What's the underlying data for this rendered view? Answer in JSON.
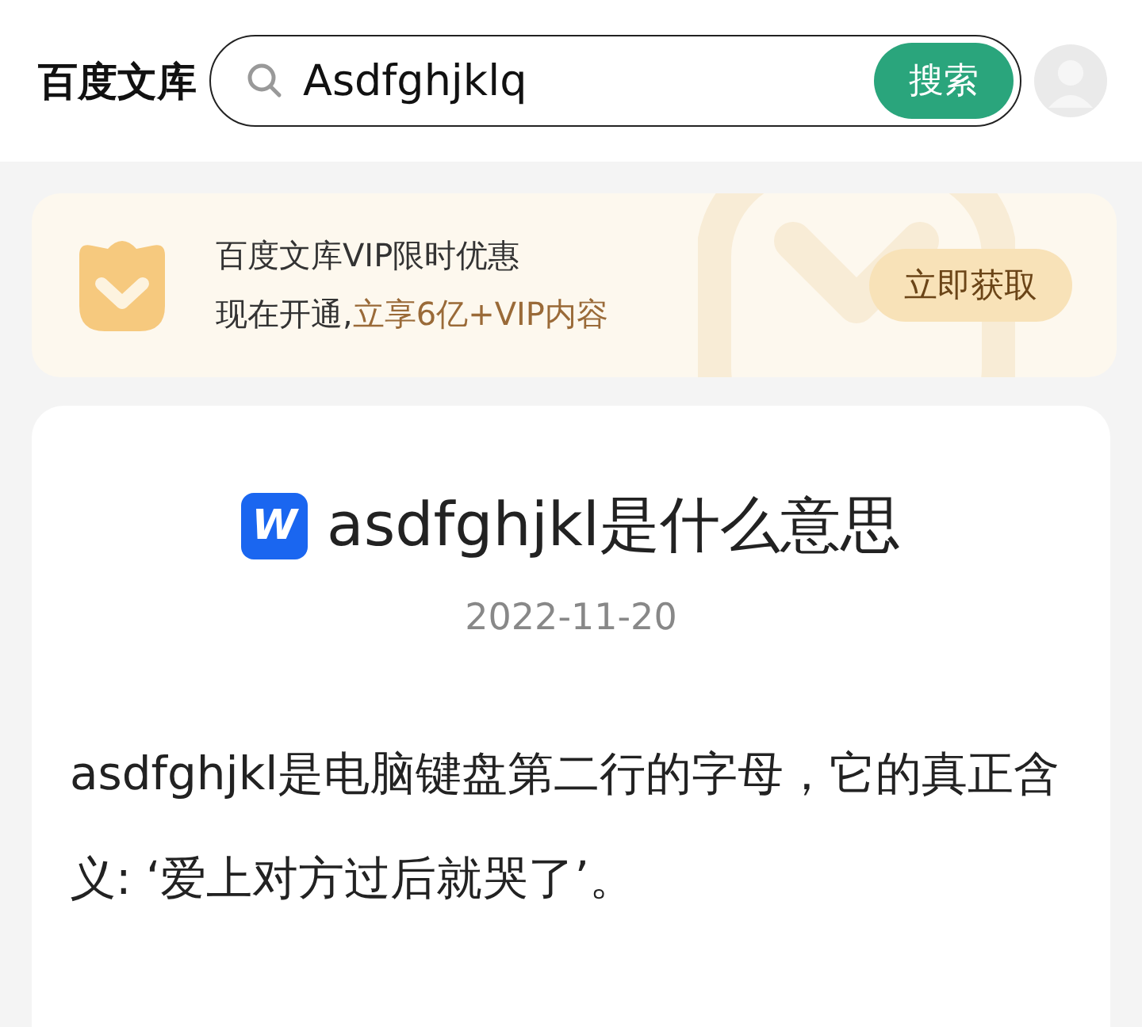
{
  "header": {
    "logo": "百度文库",
    "search": {
      "value": "Asdfghjklq",
      "button": "搜索"
    }
  },
  "promo": {
    "title": "百度文库VIP限时优惠",
    "subtitle_lead": "现在开通,",
    "subtitle_highlight": "立享6亿+VIP内容",
    "button": "立即获取"
  },
  "article": {
    "doc_icon_letter": "W",
    "title": "asdfghjkl是什么意思",
    "date": "2022-11-20",
    "body": "asdfghjkl是电脑键盘第二行的字母，它的真正含义: ‘爱上对方过后就哭了’。"
  }
}
